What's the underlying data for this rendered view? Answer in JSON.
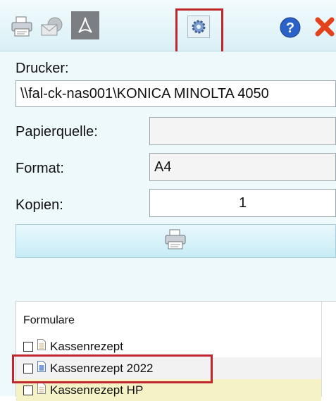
{
  "toolbar": {
    "icons": [
      "printer-icon",
      "email-icon",
      "pdf-icon",
      "settings-gear-icon",
      "help-icon",
      "close-icon"
    ]
  },
  "form": {
    "printer_label": "Drucker:",
    "printer_value": "\\\\fal-ck-nas001\\KONICA MINOLTA 4050",
    "paper_source_label": "Papierquelle:",
    "paper_source_value": "",
    "format_label": "Format:",
    "format_value": "A4",
    "copies_label": "Kopien:",
    "copies_value": "1"
  },
  "forms_list": {
    "header": "Formulare",
    "items": [
      {
        "label": "Kassenrezept"
      },
      {
        "label": "Kassenrezept 2022"
      },
      {
        "label": "Kassenrezept HP"
      }
    ]
  },
  "colors": {
    "highlight": "#c0262d",
    "accent_panel": "#eef9fc"
  }
}
